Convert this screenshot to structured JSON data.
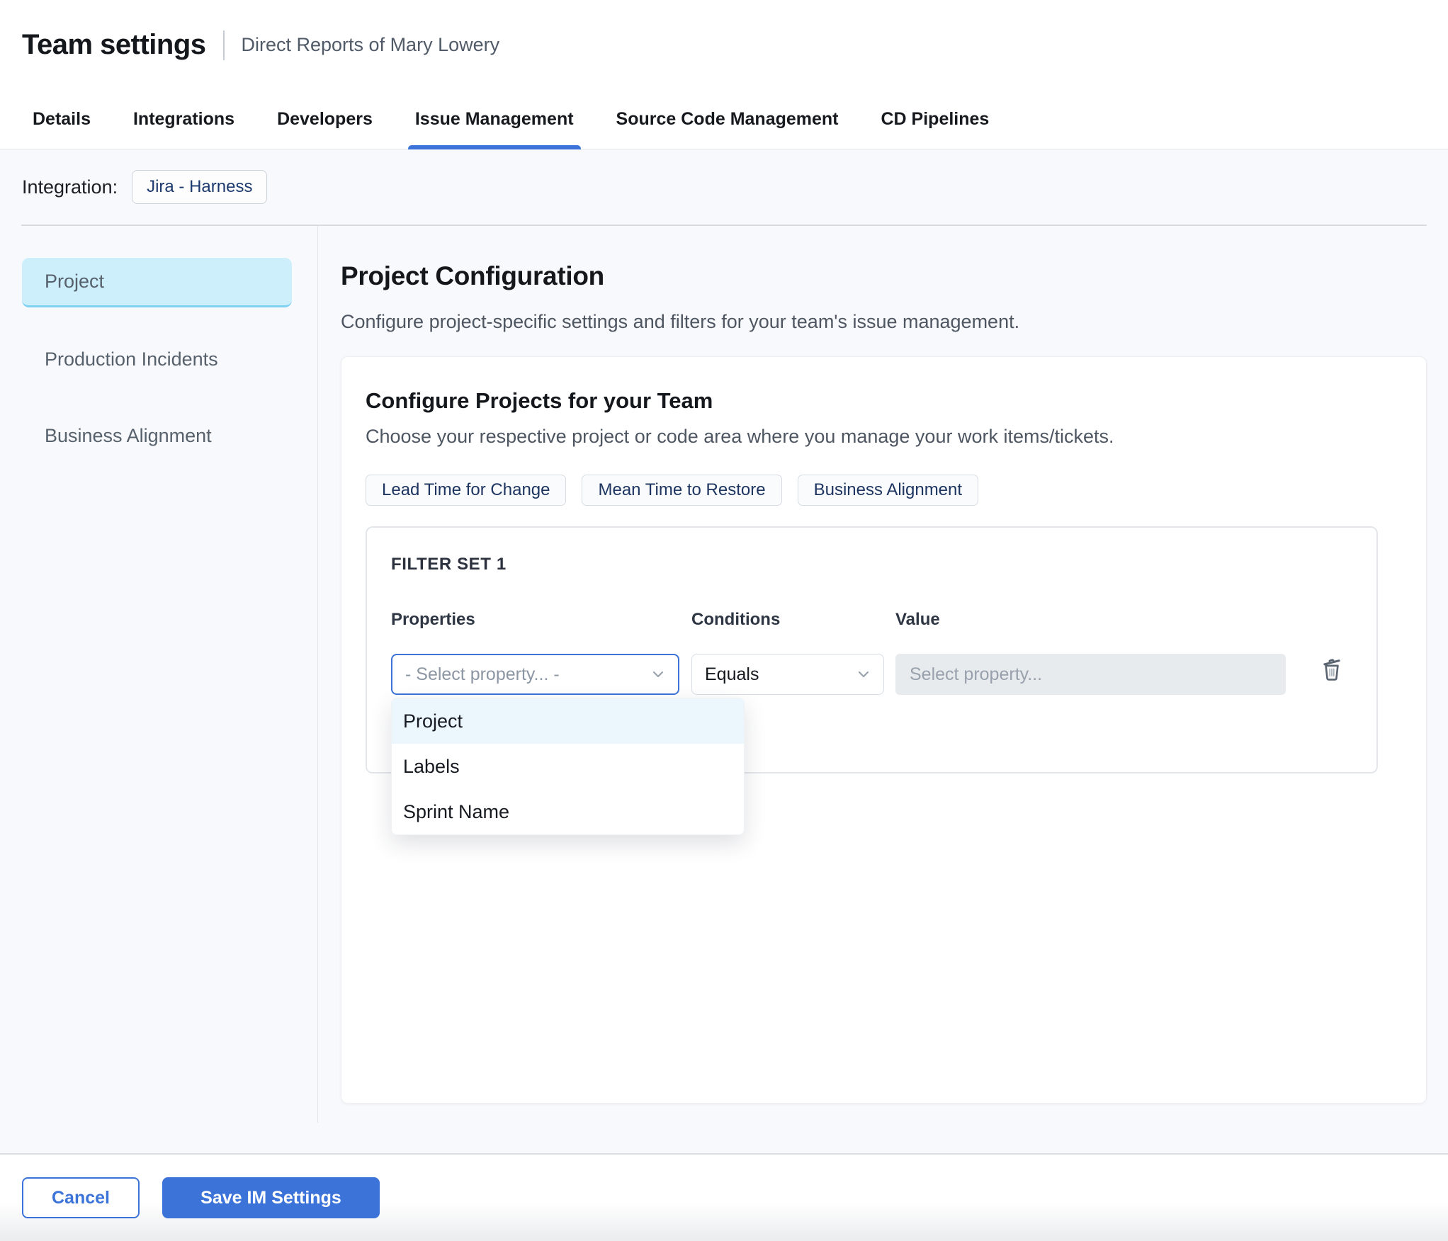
{
  "header": {
    "title": "Team settings",
    "subtitle": "Direct Reports of Mary Lowery"
  },
  "tabs": {
    "items": [
      {
        "label": "Details",
        "active": false
      },
      {
        "label": "Integrations",
        "active": false
      },
      {
        "label": "Developers",
        "active": false
      },
      {
        "label": "Issue Management",
        "active": true
      },
      {
        "label": "Source Code Management",
        "active": false
      },
      {
        "label": "CD Pipelines",
        "active": false
      }
    ]
  },
  "integration": {
    "label": "Integration:",
    "chip": "Jira - Harness"
  },
  "sidebar": {
    "items": [
      {
        "label": "Project",
        "active": true
      },
      {
        "label": "Production Incidents",
        "active": false
      },
      {
        "label": "Business Alignment",
        "active": false
      }
    ]
  },
  "main": {
    "title": "Project Configuration",
    "description": "Configure project-specific settings and filters for your team's issue management.",
    "card": {
      "title": "Configure Projects for your Team",
      "description": "Choose your respective project or code area where you manage your work items/tickets.",
      "chips": [
        "Lead Time for Change",
        "Mean Time to Restore",
        "Business Alignment"
      ],
      "filter_set": {
        "title": "FILTER SET 1",
        "columns": {
          "properties": "Properties",
          "conditions": "Conditions",
          "value": "Value"
        },
        "property_placeholder": "- Select property... -",
        "condition_value": "Equals",
        "value_placeholder": "Select property...",
        "icons": {
          "delete": "trash-icon",
          "dropdown": "chevron-down-icon"
        },
        "menu": {
          "items": [
            {
              "label": "Project",
              "highlighted": true
            },
            {
              "label": "Labels",
              "highlighted": false
            },
            {
              "label": "Sprint Name",
              "highlighted": false
            }
          ]
        }
      }
    }
  },
  "footer": {
    "cancel_label": "Cancel",
    "save_label": "Save IM Settings"
  },
  "colors": {
    "primary": "#3b73d9",
    "sidebar_active_bg": "#cdeefb",
    "menu_highlight_bg": "#ecf7fd"
  }
}
